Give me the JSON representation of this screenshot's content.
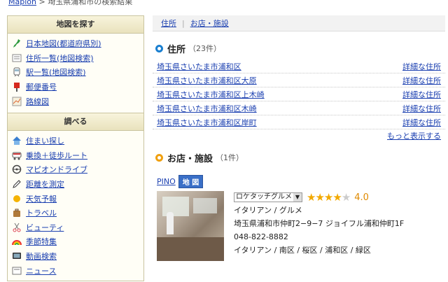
{
  "breadcrumb": {
    "root": "Mapion",
    "sep": " > ",
    "current": "埼玉県浦和市の検索結果"
  },
  "sidebar": {
    "section1": "地図を探す",
    "items1": [
      {
        "label": "日本地図(都道府県別)",
        "icon": "japan-map-icon"
      },
      {
        "label": "住所一覧(地図検索)",
        "icon": "list-icon"
      },
      {
        "label": "駅一覧(地図検索)",
        "icon": "train-icon"
      },
      {
        "label": "郵便番号",
        "icon": "postbox-icon"
      },
      {
        "label": "路線図",
        "icon": "route-map-icon"
      }
    ],
    "section2": "調べる",
    "items2": [
      {
        "label": "住まい探し",
        "icon": "house-icon"
      },
      {
        "label": "乗換＋徒歩ルート",
        "icon": "train-icon"
      },
      {
        "label": "マピオンドライブ",
        "icon": "steering-wheel-icon"
      },
      {
        "label": "距離を測定",
        "icon": "pencil-icon"
      },
      {
        "label": "天気予報",
        "icon": "sun-icon"
      },
      {
        "label": "トラベル",
        "icon": "suitcase-icon"
      },
      {
        "label": "ビューティ",
        "icon": "scissors-icon"
      },
      {
        "label": "季節特集",
        "icon": "rainbow-icon"
      },
      {
        "label": "動画検索",
        "icon": "tv-icon"
      },
      {
        "label": "ニュース",
        "icon": "news-icon"
      }
    ]
  },
  "tabs": {
    "address": "住所",
    "sep": "|",
    "shops": "お店・施設"
  },
  "address_section": {
    "title": "住所",
    "count": "（23件）",
    "detail_label": "詳細な住所",
    "rows": [
      "埼玉県さいたま市浦和区",
      "埼玉県さいたま市浦和区大原",
      "埼玉県さいたま市浦和区上木崎",
      "埼玉県さいたま市浦和区木崎",
      "埼玉県さいたま市浦和区岸町"
    ],
    "more": "もっと表示する"
  },
  "shop_section": {
    "title": "お店・施設",
    "count": "（1件）",
    "shop": {
      "name": "PINO",
      "map_badge": "地 図",
      "source_dropdown": "ロケタッチグルメ",
      "rating_value": 4.0,
      "rating_text": "4.0",
      "genre": "イタリアン / グルメ",
      "address": "埼玉県浦和市仲町2−9−7 ジョイフル浦和仲町1F",
      "phone": "048-822-8882",
      "tags": "イタリアン / 南区 / 桜区 / 浦和区 / 緑区"
    }
  },
  "colors": {
    "link": "#1a3fb0",
    "address_ring": "#1a7fd0",
    "shop_ring": "#f0a010",
    "star": "#f2a900"
  }
}
